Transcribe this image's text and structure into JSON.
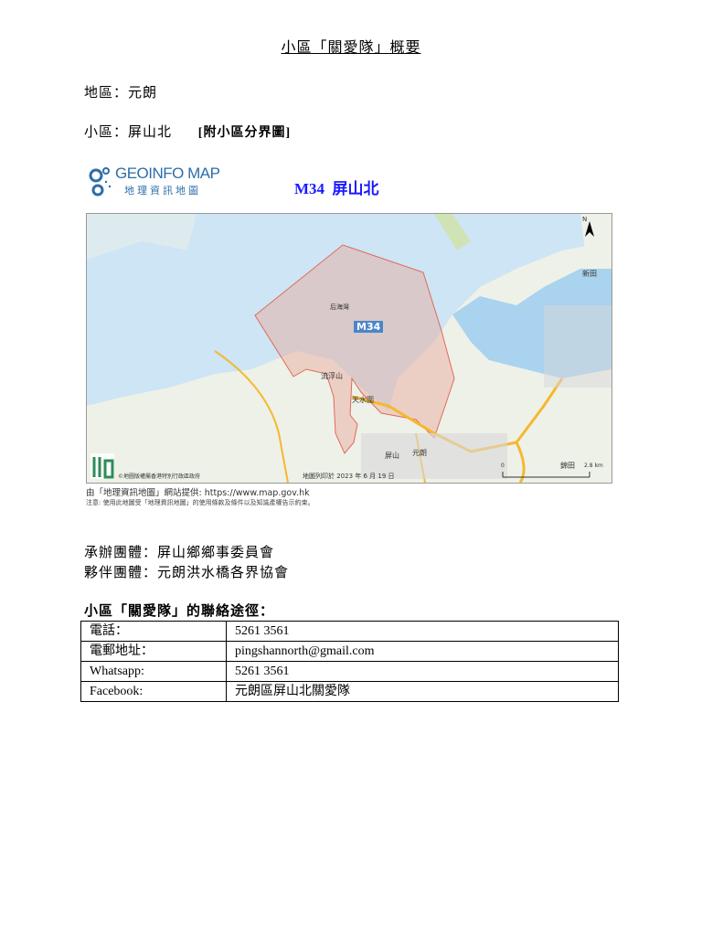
{
  "title": "小區「關愛隊」概要",
  "district": {
    "label": "地區：",
    "value": "元朗"
  },
  "subdistrict": {
    "label": "小區：",
    "value": "屏山北",
    "link": "[附小區分界圖]"
  },
  "map": {
    "logo_en": "GEOINFO MAP",
    "logo_zh": "地理資訊地圖",
    "code_title": "M34  屏山北",
    "labels": {
      "bay": "后海灣",
      "zone": "M34",
      "lau_fau_shan": "流浮山",
      "tin_shui_wai": "天水圍",
      "ping_shan": "屏山",
      "yuen_long": "元朗",
      "san_tin": "新田",
      "kam_tin": "錦田",
      "scale": "2.8 km",
      "scale_zero": "0",
      "north": "N",
      "copyright": "©地圖版權屬香港特別行政區政府",
      "print_date": "地圖列印於 2023 年 6 月 19 日"
    },
    "caption1": "由「地理資訊地圖」網站提供: https://www.map.gov.hk",
    "caption2": "注意: 使用此地圖受「地理資訊地圖」的使用條款及條件以及知識產權告示約束。",
    "colors": {
      "sea": "#cde5f4",
      "land": "#eef1e8",
      "zone": "#e8a79a",
      "road": "#f5b82e"
    }
  },
  "organizer": {
    "label": "承辦團體：",
    "value": "屏山鄉鄉事委員會"
  },
  "partner": {
    "label": "夥伴團體：",
    "value": "元朗洪水橋各界協會"
  },
  "contact": {
    "heading": "小區「關愛隊」的聯絡途徑：",
    "rows": [
      {
        "key": "電話：",
        "value": "5261 3561"
      },
      {
        "key": "電郵地址：",
        "value": "pingshannorth@gmail.com"
      },
      {
        "key": "Whatsapp:",
        "value": "5261 3561"
      },
      {
        "key": "Facebook:",
        "value": "元朗區屏山北關愛隊"
      }
    ]
  }
}
